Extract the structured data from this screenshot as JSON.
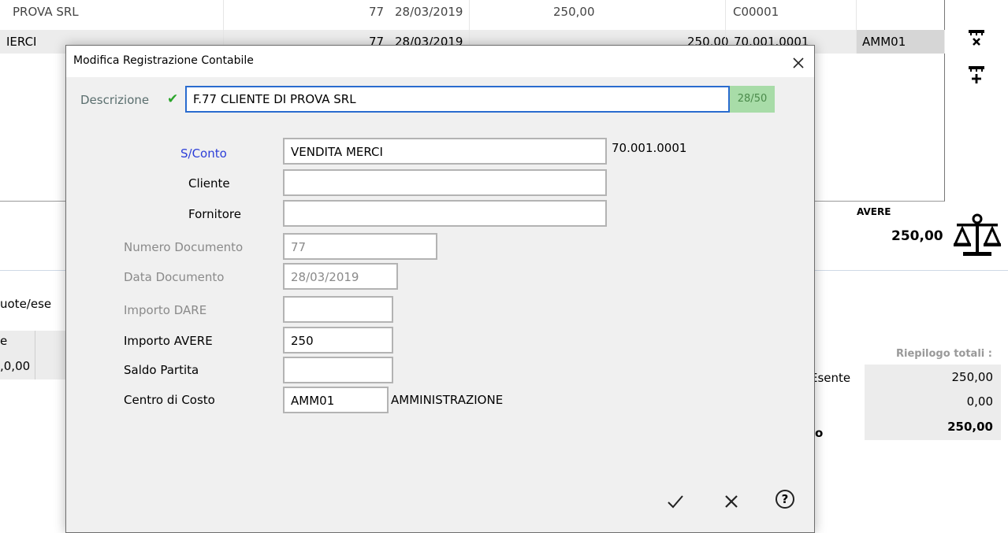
{
  "background": {
    "rows": [
      {
        "desc": "PROVA SRL",
        "num": "77",
        "date": "28/03/2019",
        "dare": "250,00",
        "conto": "C00001",
        "cc": ""
      },
      {
        "desc": "IERCI",
        "num": "77",
        "date": "28/03/2019",
        "avere": "250,00",
        "conto": "70.001.0001",
        "cc": "AMM01"
      }
    ],
    "avere_label": "AVERE",
    "avere_value": "250,00",
    "side_tab_text": "uote/ese",
    "left_cell_header": "e",
    "left_cell_value": ",0,00",
    "riepilogo_title": "Riepilogo totali :",
    "esente_label": "Esente",
    "totals_partial_label": "o",
    "riepilogo_values": [
      "250,00",
      "0,00",
      "250,00"
    ]
  },
  "dialog": {
    "title": "Modifica Registrazione Contabile",
    "descrizione_label": "Descrizione",
    "descrizione_value": "F.77    CLIENTE DI PROVA SRL",
    "descrizione_counter": "28/50",
    "fields": {
      "sconto_label": "S/Conto",
      "sconto_value": "VENDITA MERCI",
      "sconto_code": "70.001.0001",
      "cliente_label": "Cliente",
      "cliente_value": "",
      "fornitore_label": "Fornitore",
      "fornitore_value": "",
      "numdoc_label": "Numero Documento",
      "numdoc_value": "77",
      "datadoc_label": "Data Documento",
      "datadoc_value": "28/03/2019",
      "dare_label": "Importo DARE",
      "dare_value": "",
      "avere_label": "Importo AVERE",
      "avere_value": "250",
      "saldo_label": "Saldo Partita",
      "saldo_value": "",
      "cdc_label": "Centro di Costo",
      "cdc_value": "AMM01",
      "cdc_desc": "AMMINISTRAZIONE"
    },
    "buttons": {
      "confirm": "✓",
      "cancel": "✕",
      "help": "?"
    }
  },
  "icons": {
    "close": "close-icon",
    "check": "check-icon",
    "delete_row": "delete-row-icon",
    "add_row": "add-row-icon",
    "balance": "balance-scale-icon"
  }
}
